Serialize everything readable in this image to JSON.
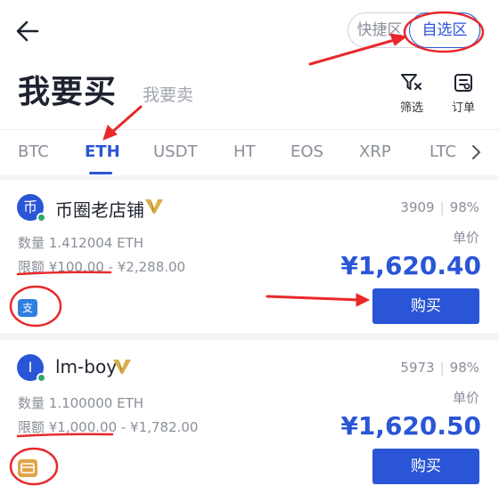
{
  "header": {
    "title": "我要买",
    "sell_note": "我要卖",
    "toggle": {
      "quick": "快捷区",
      "favorites": "自选区"
    },
    "filter_label": "筛选",
    "orders_label": "订单"
  },
  "tabs": [
    {
      "label": "BTC"
    },
    {
      "label": "ETH"
    },
    {
      "label": "USDT"
    },
    {
      "label": "HT"
    },
    {
      "label": "EOS"
    },
    {
      "label": "XRP"
    },
    {
      "label": "LTC"
    }
  ],
  "active_tab": "ETH",
  "listings": [
    {
      "avatar_char": "币",
      "merchant": "币圈老店铺",
      "orders": "3909",
      "completion": "98%",
      "quantity": "数量 1.412004 ETH",
      "unit_label": "单价",
      "limit": "限额 ¥100.00 - ¥2,288.00",
      "price": "¥1,620.40",
      "payment_icon": "alipay-icon",
      "payment_char": "支",
      "buy_label": "购买"
    },
    {
      "avatar_char": "I",
      "merchant": "lm-boy",
      "orders": "5973",
      "completion": "98%",
      "quantity": "数量 1.100000 ETH",
      "unit_label": "单价",
      "limit": "限额 ¥1,000.00 - ¥1,782.00",
      "price": "¥1,620.50",
      "payment_icon": "bank-card-icon",
      "payment_char": "",
      "buy_label": "购买"
    }
  ],
  "colors": {
    "accent": "#2a55d6",
    "annotation": "#e8282b",
    "online": "#2fa86b",
    "badge_gold": "#d8b04a"
  }
}
